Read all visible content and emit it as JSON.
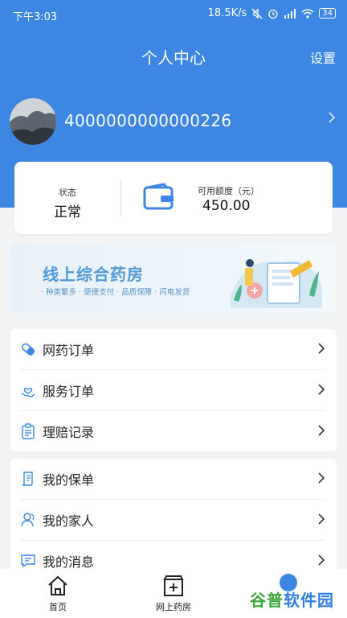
{
  "status_bar": {
    "time": "下午3:03",
    "network_speed": "18.5K/s",
    "battery": "34"
  },
  "header": {
    "title": "个人中心",
    "settings_label": "设置",
    "background_color": "#3d86e4"
  },
  "profile": {
    "username": "4000000000000226"
  },
  "account": {
    "status_label": "状态",
    "status_value": "正常",
    "credit_label": "可用额度（元）",
    "credit_value": "450.00"
  },
  "banner": {
    "title": "线上综合药房",
    "subtitle": "· 种类繁多 · 便捷支付 · 品质保障 · 闪电发货"
  },
  "menu_group_1": [
    {
      "label": "网药订单",
      "icon": "pill-icon"
    },
    {
      "label": "服务订单",
      "icon": "hand-heart-icon"
    },
    {
      "label": "理赔记录",
      "icon": "clipboard-icon"
    }
  ],
  "menu_group_2": [
    {
      "label": "我的保单",
      "icon": "policy-document-icon"
    },
    {
      "label": "我的家人",
      "icon": "family-icon"
    },
    {
      "label": "我的消息",
      "icon": "message-icon"
    }
  ],
  "tabbar": {
    "tabs": [
      {
        "label": "首页",
        "icon": "home-icon"
      },
      {
        "label": "网上药房",
        "icon": "pharmacy-icon"
      }
    ]
  },
  "watermark": {
    "text_green": "谷普",
    "text_blue": "软件园"
  }
}
